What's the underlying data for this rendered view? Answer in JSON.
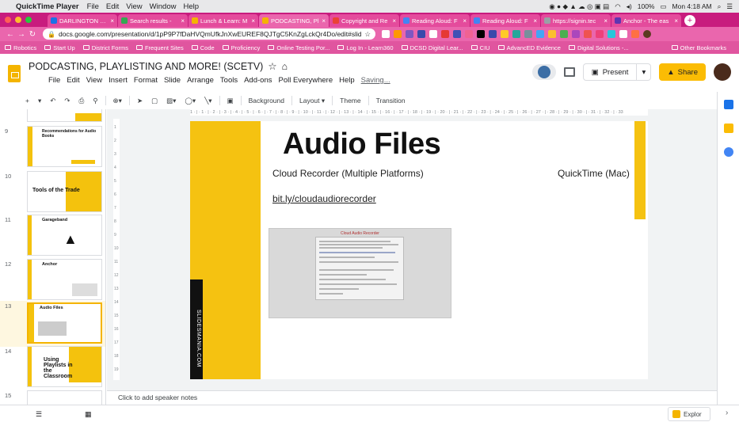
{
  "mac": {
    "app": "QuickTime Player",
    "menus": [
      "File",
      "Edit",
      "View",
      "Window",
      "Help"
    ],
    "battery": "100%",
    "clock": "Mon 4:18 AM"
  },
  "tabs": [
    {
      "title": "DARLINGTON CO.",
      "color": "#1a73e8"
    },
    {
      "title": "Search results -",
      "color": "#34a853"
    },
    {
      "title": "Lunch & Learn: M",
      "color": "#f4b400"
    },
    {
      "title": "PODCASTING, Pl",
      "color": "#f4b400"
    },
    {
      "title": "Copyright and Re",
      "color": "#ea4335"
    },
    {
      "title": "Reading Aloud: F",
      "color": "#4285f4"
    },
    {
      "title": "Reading Aloud: F",
      "color": "#4285f4"
    },
    {
      "title": "https://signin.tec",
      "color": "#9aa0a6"
    },
    {
      "title": "Anchor - The eas",
      "color": "#5e35b1"
    }
  ],
  "address": {
    "url": "docs.google.com/presentation/d/1pP9P7fDaHVQmUfkJnXwEUREF8QJTgC5KnZgLckQr4Do/edit#slide=id..."
  },
  "bookmarks": [
    "Robotics",
    "Start Up",
    "District Forms",
    "Frequent Sites",
    "Code",
    "Proficiency",
    "Online Testing Por...",
    "Log In - Learn360",
    "DCSD Digital Lear...",
    "CIU",
    "AdvancED Evidence",
    "Digital Solutions -..."
  ],
  "bookmarks_other": "Other Bookmarks",
  "doc": {
    "title": "PODCASTING, PLAYLISTING AND MORE! (SCETV)",
    "menus": [
      "File",
      "Edit",
      "View",
      "Insert",
      "Format",
      "Slide",
      "Arrange",
      "Tools",
      "Add-ons",
      "Poll Everywhere",
      "Help"
    ],
    "saving": "Saving...",
    "present": "Present",
    "share": "Share"
  },
  "toolbar": {
    "background": "Background",
    "layout": "Layout",
    "theme": "Theme",
    "transition": "Transition"
  },
  "ruler_marks": "1 · | · 1 · | · 2 · | · 3 · | · 4 · | · 5 · | · 6 · | · 7 · | · 8 · | · 9 · | · 10 · | · 11 · | · 12 · | · 13 · | · 14 · | · 15 · | · 16 · | · 17 · | · 18 · | · 19 · | · 20 · | · 21 · | · 22 · | · 23 · | · 24 · | · 25 · | · 26 · | · 27 · | · 28 · | · 29 · | · 30 · | · 31 · | · 32 · | · 33",
  "vruler_marks": [
    "1",
    "2",
    "3",
    "4",
    "5",
    "6",
    "7",
    "8",
    "9",
    "10",
    "11",
    "12",
    "13",
    "14",
    "15",
    "16",
    "17",
    "18",
    "19"
  ],
  "filmstrip": {
    "slides": [
      {
        "num": "9",
        "title": "Recommendations for Audio Books"
      },
      {
        "num": "10",
        "title": "Tools of the Trade"
      },
      {
        "num": "11",
        "title": "Garageband"
      },
      {
        "num": "12",
        "title": "Anchor"
      },
      {
        "num": "13",
        "title": "Audio Files"
      },
      {
        "num": "14",
        "title": "Using Playlists in the Classroom"
      },
      {
        "num": "15",
        "title": ""
      }
    ]
  },
  "slide": {
    "title": "Audio Files",
    "subtitle_left": "Cloud Recorder (Multiple Platforms)",
    "subtitle_right": "QuickTime (Mac)",
    "link": "bit.ly/cloudaudiorecorder",
    "vertical_text": "SLIDESMANIA.COM",
    "screenshot_title": "Cloud Audio Recorder"
  },
  "notes": {
    "placeholder": "Click to add speaker notes"
  },
  "explore": {
    "label": "Explor"
  }
}
